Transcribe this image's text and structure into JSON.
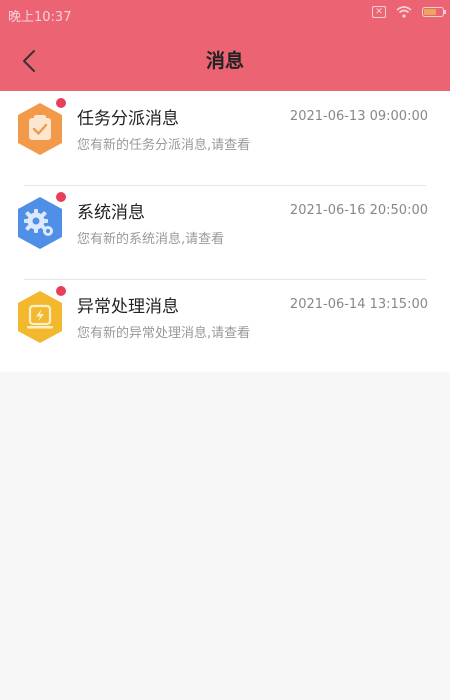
{
  "status_bar": {
    "time": "晚上10:37"
  },
  "header": {
    "title": "消息"
  },
  "messages": [
    {
      "title": "任务分派消息",
      "time": "2021-06-13 09:00:00",
      "desc": "您有新的任务分派消息,请查看",
      "icon": "clipboard-check-icon",
      "color": "#f39a4a"
    },
    {
      "title": "系统消息",
      "time": "2021-06-16 20:50:00",
      "desc": "您有新的系统消息,请查看",
      "icon": "gear-icon",
      "color": "#4f8fe8"
    },
    {
      "title": "异常处理消息",
      "time": "2021-06-14 13:15:00",
      "desc": "您有新的异常处理消息,请查看",
      "icon": "lightning-box-icon",
      "color": "#f3b82e"
    }
  ],
  "colors": {
    "header": "#ec6474",
    "badge": "#e8405a"
  }
}
